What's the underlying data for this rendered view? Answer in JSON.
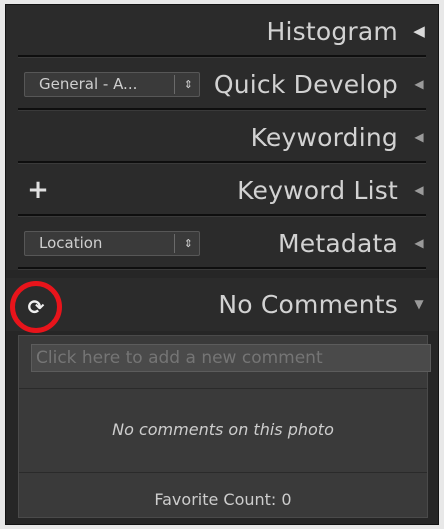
{
  "panels": {
    "histogram": {
      "title": "Histogram",
      "arrow": "◀"
    },
    "quick_develop": {
      "title": "Quick Develop",
      "preset_value": "General - A...",
      "stepper": "⇕",
      "arrow": "◀"
    },
    "keywording": {
      "title": "Keywording",
      "arrow": "◀"
    },
    "keyword_list": {
      "title": "Keyword List",
      "plus": "+",
      "arrow": "◀"
    },
    "metadata": {
      "title": "Metadata",
      "preset_value": "Location",
      "stepper": "⇕",
      "arrow": "◀"
    },
    "comments": {
      "title": "No Comments",
      "refresh_icon": "⟳",
      "arrow": "▼",
      "input_placeholder": "Click here to add a new comment",
      "empty_message": "No comments on this photo",
      "favorite_count": "Favorite Count: 0"
    }
  },
  "colors": {
    "highlight_ring": "#e8141b",
    "panel_bg": "#2b2b2b",
    "text": "#d2d2d2"
  }
}
